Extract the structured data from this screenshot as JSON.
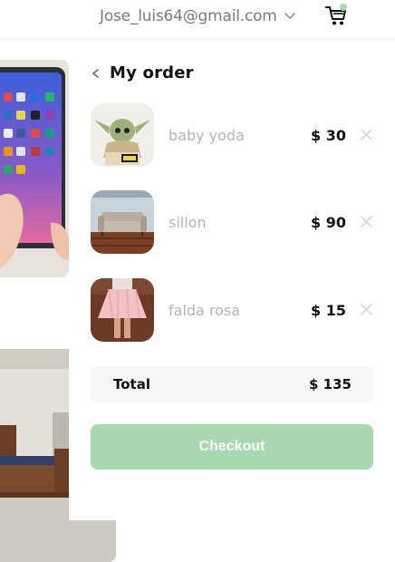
{
  "header": {
    "user_email": "Jose_luis64@gmail.com",
    "dropdown_icon": "chevron-down-icon",
    "cart_icon": "shopping-cart-icon",
    "cart_indicator_color": "#a8d8b0"
  },
  "order": {
    "title": "My order",
    "back_icon": "chevron-left-icon",
    "items": [
      {
        "name": "baby yoda",
        "price": "$ 30",
        "remove_icon": "close-icon"
      },
      {
        "name": "sillon",
        "price": "$ 90",
        "remove_icon": "close-icon"
      },
      {
        "name": "falda rosa",
        "price": "$ 15",
        "remove_icon": "close-icon"
      }
    ],
    "total_label": "Total",
    "total_value": "$ 135",
    "checkout_label": "Checkout"
  },
  "colors": {
    "accent": "#a8d8b0",
    "muted_text": "#b5b5b5",
    "email_text": "#7a7a7a"
  }
}
